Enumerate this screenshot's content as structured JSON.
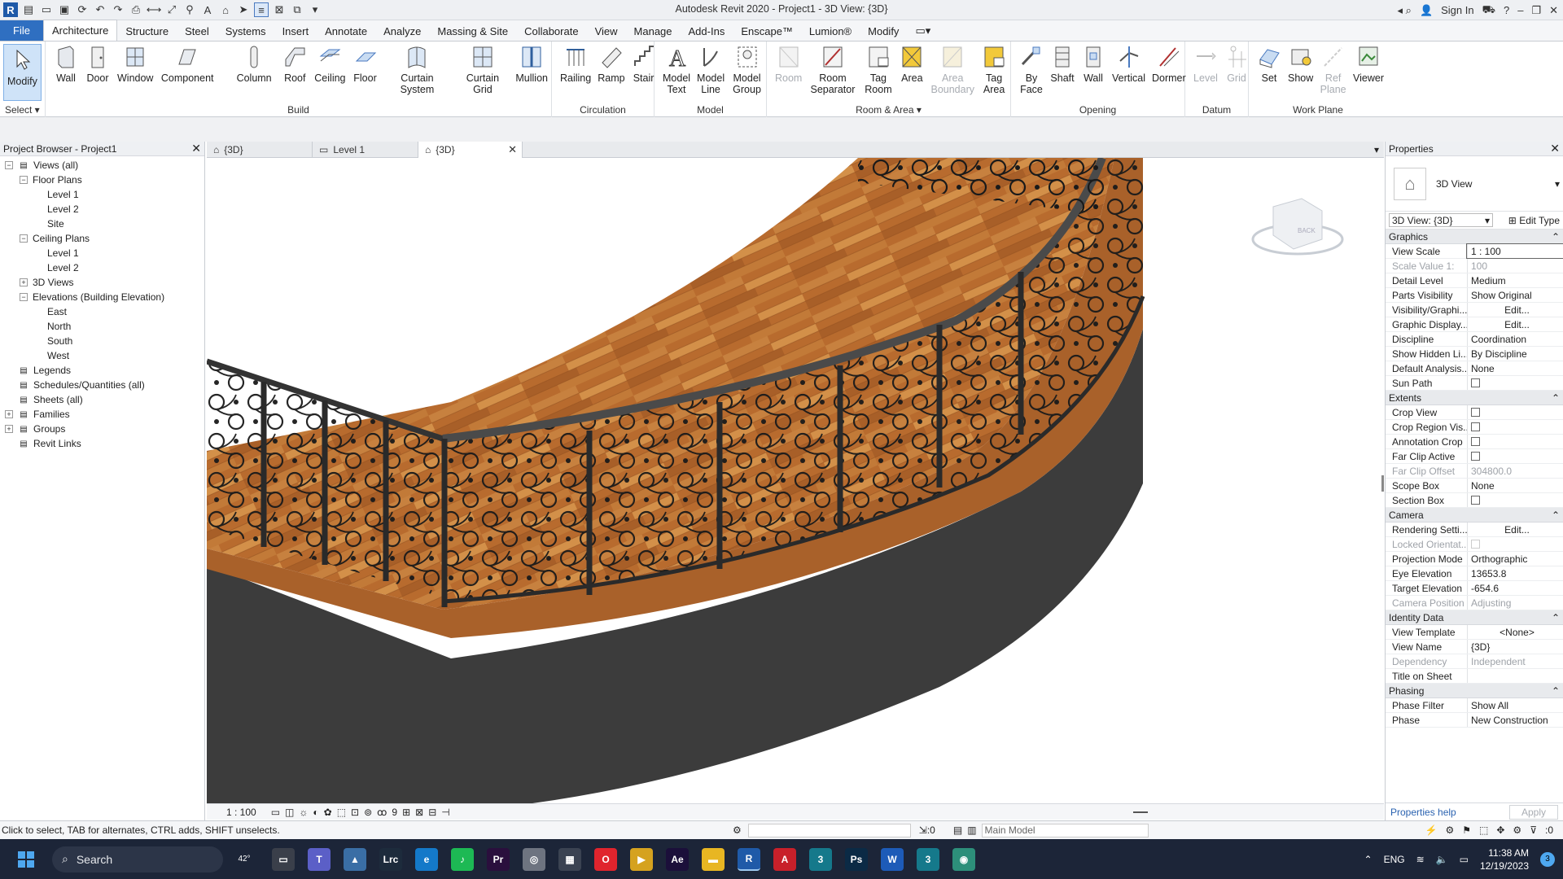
{
  "app": {
    "title": "Autodesk Revit 2020 - Project1 - 3D View: {3D}",
    "sign_in": "Sign In"
  },
  "menu": [
    "File",
    "Architecture",
    "Structure",
    "Steel",
    "Systems",
    "Insert",
    "Annotate",
    "Analyze",
    "Massing & Site",
    "Collaborate",
    "View",
    "Manage",
    "Add-Ins",
    "Enscape™",
    "Lumion®",
    "Modify"
  ],
  "ribbon": {
    "select": {
      "tools": [
        {
          "label": "Modify",
          "icon": "cursor-icon"
        }
      ],
      "label": "Select ▾"
    },
    "build": {
      "tools": [
        {
          "label": "Wall",
          "icon": "wall-icon"
        },
        {
          "label": "Door",
          "icon": "door-icon"
        },
        {
          "label": "Window",
          "icon": "window-icon"
        },
        {
          "label": "Component",
          "icon": "component-icon"
        },
        {
          "label": "Column",
          "icon": "column-icon"
        },
        {
          "label": "Roof",
          "icon": "roof-icon"
        },
        {
          "label": "Ceiling",
          "icon": "ceiling-icon"
        },
        {
          "label": "Floor",
          "icon": "floor-icon"
        },
        {
          "label": "Curtain System",
          "icon": "curtain-system-icon"
        },
        {
          "label": "Curtain Grid",
          "icon": "curtain-grid-icon"
        },
        {
          "label": "Mullion",
          "icon": "mullion-icon"
        }
      ],
      "label": "Build"
    },
    "circulation": {
      "tools": [
        {
          "label": "Railing",
          "icon": "railing-icon"
        },
        {
          "label": "Ramp",
          "icon": "ramp-icon"
        },
        {
          "label": "Stair",
          "icon": "stair-icon"
        }
      ],
      "label": "Circulation"
    },
    "model": {
      "tools": [
        {
          "label": "Model Text",
          "icon": "model-text-icon"
        },
        {
          "label": "Model Line",
          "icon": "model-line-icon"
        },
        {
          "label": "Model Group",
          "icon": "model-group-icon"
        }
      ],
      "label": "Model"
    },
    "room": {
      "tools": [
        {
          "label": "Room",
          "icon": "room-icon",
          "disabled": true
        },
        {
          "label": "Room Separator",
          "icon": "room-separator-icon"
        },
        {
          "label": "Tag Room",
          "icon": "tag-room-icon"
        },
        {
          "label": "Area",
          "icon": "area-icon"
        },
        {
          "label": "Area Boundary",
          "icon": "area-boundary-icon",
          "disabled": true
        },
        {
          "label": "Tag Area",
          "icon": "tag-area-icon"
        }
      ],
      "label": "Room & Area ▾"
    },
    "opening": {
      "tools": [
        {
          "label": "By Face",
          "icon": "by-face-icon"
        },
        {
          "label": "Shaft",
          "icon": "shaft-icon"
        },
        {
          "label": "Wall",
          "icon": "wall-opening-icon"
        },
        {
          "label": "Vertical",
          "icon": "vertical-icon"
        },
        {
          "label": "Dormer",
          "icon": "dormer-icon"
        }
      ],
      "label": "Opening"
    },
    "datum": {
      "tools": [
        {
          "label": "Level",
          "icon": "level-icon",
          "disabled": true
        },
        {
          "label": "Grid",
          "icon": "grid-icon",
          "disabled": true
        }
      ],
      "label": "Datum"
    },
    "workplane": {
      "tools": [
        {
          "label": "Set",
          "icon": "set-icon"
        },
        {
          "label": "Show",
          "icon": "show-icon"
        },
        {
          "label": "Ref Plane",
          "icon": "ref-plane-icon",
          "disabled": true
        },
        {
          "label": "Viewer",
          "icon": "viewer-icon"
        }
      ],
      "label": "Work Plane"
    }
  },
  "browser": {
    "title": "Project Browser - Project1",
    "nodes": [
      {
        "label": "Views (all)",
        "level": 0,
        "toggle": "−"
      },
      {
        "label": "Floor Plans",
        "level": 1,
        "toggle": "−"
      },
      {
        "label": "Level 1",
        "level": 2
      },
      {
        "label": "Level 2",
        "level": 2
      },
      {
        "label": "Site",
        "level": 2
      },
      {
        "label": "Ceiling Plans",
        "level": 1,
        "toggle": "−"
      },
      {
        "label": "Level 1",
        "level": 2
      },
      {
        "label": "Level 2",
        "level": 2
      },
      {
        "label": "3D Views",
        "level": 1,
        "toggle": "+"
      },
      {
        "label": "Elevations (Building Elevation)",
        "level": 1,
        "toggle": "−"
      },
      {
        "label": "East",
        "level": 2
      },
      {
        "label": "North",
        "level": 2
      },
      {
        "label": "South",
        "level": 2
      },
      {
        "label": "West",
        "level": 2
      },
      {
        "label": "Legends",
        "level": 0,
        "icon": true
      },
      {
        "label": "Schedules/Quantities (all)",
        "level": 0,
        "icon": true
      },
      {
        "label": "Sheets (all)",
        "level": 0,
        "icon": true
      },
      {
        "label": "Families",
        "level": 0,
        "toggle": "+",
        "icon": true
      },
      {
        "label": "Groups",
        "level": 0,
        "toggle": "+",
        "icon": true
      },
      {
        "label": "Revit Links",
        "level": 0,
        "icon": true
      }
    ]
  },
  "view_tabs": [
    {
      "label": "{3D}"
    },
    {
      "label": "Level 1"
    },
    {
      "label": "{3D}",
      "active": true
    }
  ],
  "view_bar": {
    "scale": "1 : 100"
  },
  "properties": {
    "title": "Properties",
    "type_name": "3D View",
    "instance": "3D View: {3D}",
    "edit_type": "Edit Type",
    "groups": [
      {
        "name": "Graphics",
        "rows": [
          {
            "k": "View Scale",
            "v": "1 : 100",
            "boxed": true
          },
          {
            "k": "Scale Value    1:",
            "v": "100",
            "gray": true
          },
          {
            "k": "Detail Level",
            "v": "Medium"
          },
          {
            "k": "Parts Visibility",
            "v": "Show Original"
          },
          {
            "k": "Visibility/Graphi...",
            "v": "Edit...",
            "btn": true
          },
          {
            "k": "Graphic Display...",
            "v": "Edit...",
            "btn": true
          },
          {
            "k": "Discipline",
            "v": "Coordination"
          },
          {
            "k": "Show Hidden Li...",
            "v": "By Discipline"
          },
          {
            "k": "Default Analysis...",
            "v": "None"
          },
          {
            "k": "Sun Path",
            "v": "",
            "cb": true
          }
        ]
      },
      {
        "name": "Extents",
        "rows": [
          {
            "k": "Crop View",
            "v": "",
            "cb": true
          },
          {
            "k": "Crop Region Vis...",
            "v": "",
            "cb": true
          },
          {
            "k": "Annotation Crop",
            "v": "",
            "cb": true
          },
          {
            "k": "Far Clip Active",
            "v": "",
            "cb": true
          },
          {
            "k": "Far Clip Offset",
            "v": "304800.0",
            "gray": true
          },
          {
            "k": "Scope Box",
            "v": "None"
          },
          {
            "k": "Section Box",
            "v": "",
            "cb": true
          }
        ]
      },
      {
        "name": "Camera",
        "rows": [
          {
            "k": "Rendering Setti...",
            "v": "Edit...",
            "btn": true
          },
          {
            "k": "Locked Orientat...",
            "v": "",
            "cb": true,
            "gray": true
          },
          {
            "k": "Projection Mode",
            "v": "Orthographic"
          },
          {
            "k": "Eye Elevation",
            "v": "13653.8"
          },
          {
            "k": "Target Elevation",
            "v": "-654.6"
          },
          {
            "k": "Camera Position",
            "v": "Adjusting",
            "gray": true
          }
        ]
      },
      {
        "name": "Identity Data",
        "rows": [
          {
            "k": "View Template",
            "v": "<None>",
            "btn": true
          },
          {
            "k": "View Name",
            "v": "{3D}"
          },
          {
            "k": "Dependency",
            "v": "Independent",
            "gray": true
          },
          {
            "k": "Title on Sheet",
            "v": ""
          }
        ]
      },
      {
        "name": "Phasing",
        "rows": [
          {
            "k": "Phase Filter",
            "v": "Show All"
          },
          {
            "k": "Phase",
            "v": "New Construction"
          }
        ]
      }
    ],
    "help": "Properties help",
    "apply": "Apply"
  },
  "status": {
    "text": "Click to select, TAB for alternates, CTRL adds, SHIFT unselects.",
    "zero": ":0",
    "model": "Main Model",
    "filter": ":0"
  },
  "viewcube": {
    "face": "BACK"
  },
  "taskbar": {
    "search": "Search",
    "weather": "42°",
    "time": "11:38 AM",
    "date": "12/19/2023",
    "lang": "ENG",
    "notif": "3",
    "apps": [
      {
        "name": "explorer",
        "color": "#3a3f4a",
        "glyph": "▭"
      },
      {
        "name": "teams",
        "color": "#5b5fc7",
        "glyph": "T"
      },
      {
        "name": "photos",
        "color": "#3a6ea5",
        "glyph": "▲"
      },
      {
        "name": "lightroom",
        "color": "#1d2b3c",
        "glyph": "Lrc"
      },
      {
        "name": "edge",
        "color": "#1479c9",
        "glyph": "e"
      },
      {
        "name": "spotify",
        "color": "#1db954",
        "glyph": "♪"
      },
      {
        "name": "premiere",
        "color": "#2a0f3d",
        "glyph": "Pr"
      },
      {
        "name": "disk",
        "color": "#6e7480",
        "glyph": "◎"
      },
      {
        "name": "calculator",
        "color": "#3b4352",
        "glyph": "▦"
      },
      {
        "name": "opera",
        "color": "#e0242d",
        "glyph": "O"
      },
      {
        "name": "media",
        "color": "#d5a21f",
        "glyph": "▶"
      },
      {
        "name": "after-effects",
        "color": "#1b0f3a",
        "glyph": "Ae"
      },
      {
        "name": "file-explorer",
        "color": "#e8b622",
        "glyph": "▬"
      },
      {
        "name": "revit",
        "color": "#1f5aa8",
        "glyph": "R"
      },
      {
        "name": "autocad",
        "color": "#c8202a",
        "glyph": "A"
      },
      {
        "name": "3dsmax",
        "color": "#15798b",
        "glyph": "3"
      },
      {
        "name": "photoshop",
        "color": "#0b2a45",
        "glyph": "Ps"
      },
      {
        "name": "word",
        "color": "#1d5bb8",
        "glyph": "W"
      },
      {
        "name": "3dsmax2",
        "color": "#15798b",
        "glyph": "3"
      },
      {
        "name": "chrome-like",
        "color": "#2d8f7a",
        "glyph": "◉"
      }
    ]
  }
}
